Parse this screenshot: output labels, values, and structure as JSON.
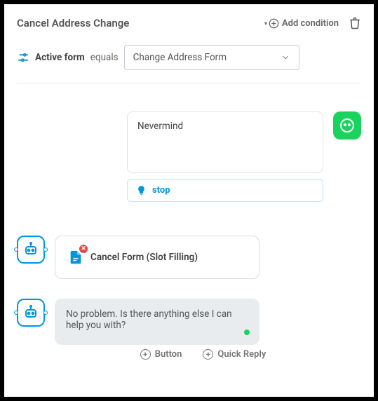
{
  "header": {
    "title": "Cancel Address Change",
    "add_condition_label": "Add condition"
  },
  "condition": {
    "field_label": "Active form",
    "operator": "equals",
    "value": "Change Address Form"
  },
  "user_turn": {
    "message": "Nevermind",
    "intent_label": "stop"
  },
  "bot_action": {
    "label": "Cancel Form (Slot Filling)"
  },
  "bot_reply": {
    "text": "No problem. Is there anything else I can help you with?"
  },
  "footer": {
    "button_label": "Button",
    "quick_reply_label": "Quick Reply"
  }
}
